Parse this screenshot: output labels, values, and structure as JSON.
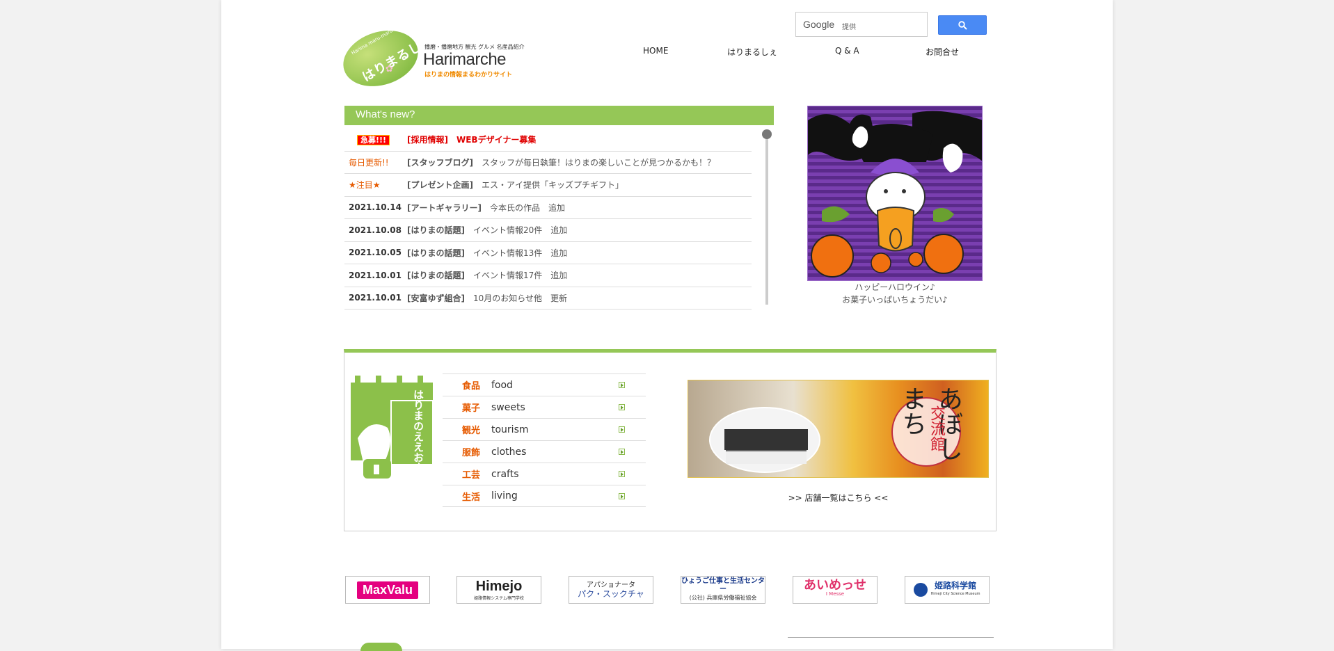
{
  "header": {
    "logo": {
      "oval_text": "はりまるしぇ",
      "oval_sub": "Harima maru-maru mall",
      "small_line": "播磨・播磨地方 観光 グルメ 名産品紹介",
      "name": "Harimarche",
      "tagline": "はりまの情報まるわかりサイト"
    },
    "search": {
      "brand": "Google",
      "provided": "提供",
      "button_icon": "search-icon"
    },
    "nav": [
      {
        "label": "HOME"
      },
      {
        "label": "はりまるしぇ"
      },
      {
        "label": "Q & A"
      },
      {
        "label": "お問合せ"
      }
    ]
  },
  "news": {
    "title": "What's new?",
    "items": [
      {
        "date": "急募!!!",
        "category": "[採用情報]",
        "text": "WEBデザイナー募集",
        "style": "badge",
        "hot": true
      },
      {
        "date": "毎日更新!!",
        "category": "[スタッフブログ]",
        "text": "スタッフが毎日執筆！はりまの楽しいことが見つかるかも！？",
        "style": "red",
        "hot": false
      },
      {
        "date": "★注目★",
        "category": "[プレゼント企画]",
        "text": "エス・アイ提供「キッズプチギフト」",
        "style": "red",
        "hot": false
      },
      {
        "date": "2021.10.14",
        "category": "[アートギャラリー]",
        "text": "今本氏の作品　追加",
        "style": "",
        "hot": false
      },
      {
        "date": "2021.10.08",
        "category": "[はりまの話題]",
        "text": "イベント情報20件　追加",
        "style": "",
        "hot": false
      },
      {
        "date": "2021.10.05",
        "category": "[はりまの話題]",
        "text": "イベント情報13件　追加",
        "style": "",
        "hot": false
      },
      {
        "date": "2021.10.01",
        "category": "[はりまの話題]",
        "text": "イベント情報17件　追加",
        "style": "",
        "hot": false
      },
      {
        "date": "2021.10.01",
        "category": "[安富ゆず組合]",
        "text": "10月のお知らせ他　更新",
        "style": "",
        "hot": false
      }
    ]
  },
  "feature": {
    "caption_line1": "ハッピーハロウイン♪",
    "caption_line2": "お菓子いっぱいちょうだい♪"
  },
  "shops": {
    "sign_text": "はりまのええお店",
    "categories": [
      {
        "jp": "食品",
        "en": "food"
      },
      {
        "jp": "菓子",
        "en": "sweets"
      },
      {
        "jp": "観光",
        "en": "tourism"
      },
      {
        "jp": "服飾",
        "en": "clothes"
      },
      {
        "jp": "工芸",
        "en": "crafts"
      },
      {
        "jp": "生活",
        "en": "living"
      }
    ],
    "banner": {
      "title": "あぼしまち",
      "subtitle": "交流館"
    },
    "list_link": ">> 店舗一覧はこちら <<"
  },
  "sponsors": [
    {
      "name": "MaxValu"
    },
    {
      "name": "Himejo",
      "sub": "姫路情報システム専門学校"
    },
    {
      "name": "アパショナータ",
      "sub": "パク・スックチャ"
    },
    {
      "name": "ひょうご仕事と生活センター",
      "sub": "(公社) 兵庫県労働福祉協会"
    },
    {
      "name": "あいめっせ",
      "sub": "I Messe"
    },
    {
      "name": "姫路科学館",
      "sub": "Himeji City Science Museum"
    }
  ],
  "colors": {
    "accent_green": "#95c757",
    "accent_orange": "#e65a00",
    "hot_red": "#e00000",
    "search_blue": "#4a8af4"
  }
}
